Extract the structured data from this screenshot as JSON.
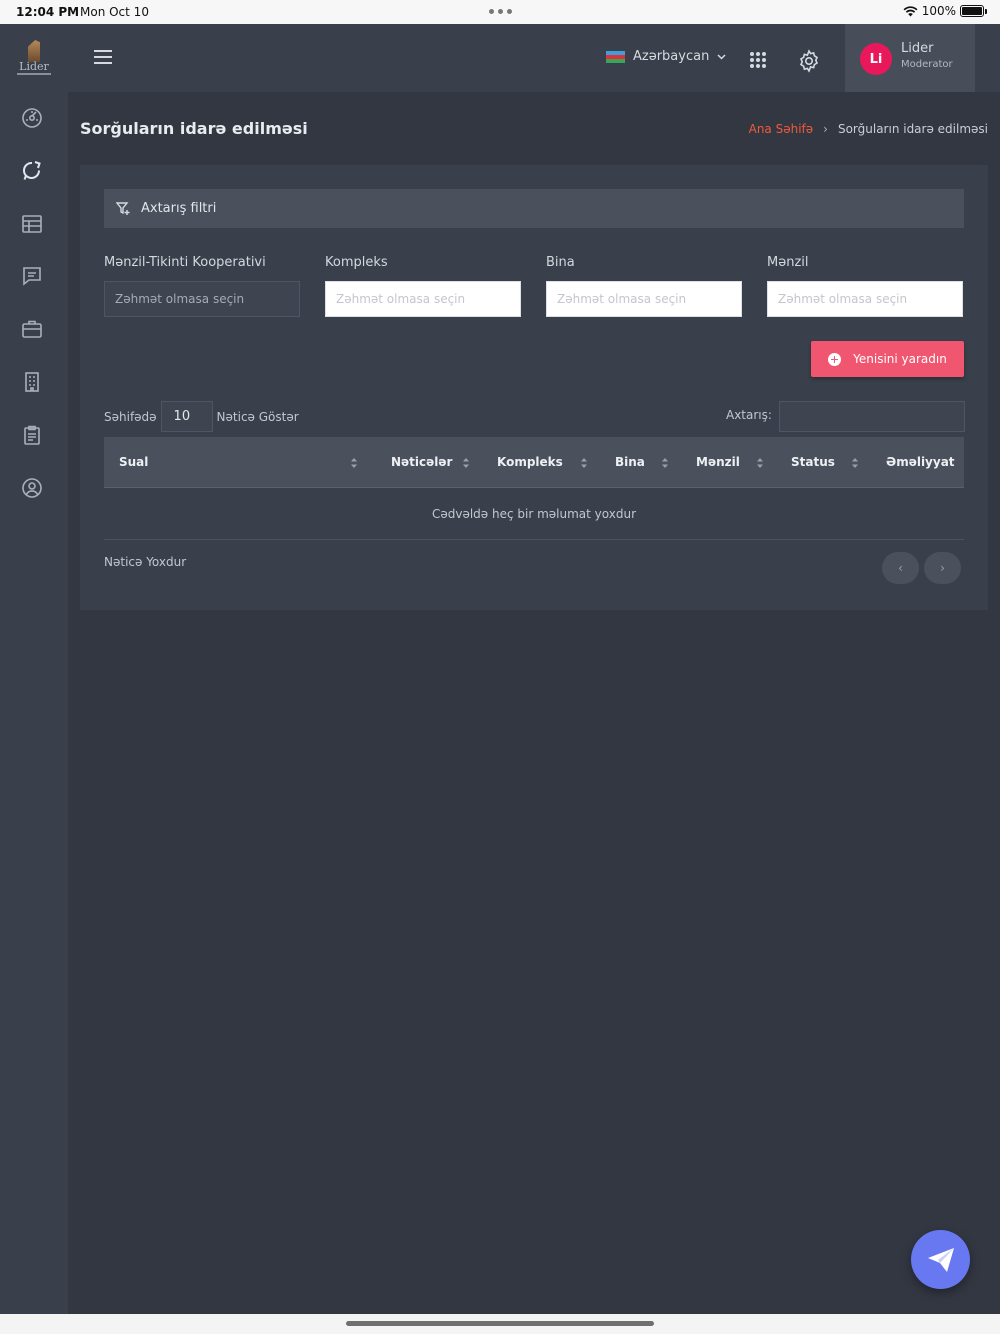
{
  "statusbar": {
    "time": "12:04 PM",
    "date": "Mon Oct 10",
    "battery": "100%"
  },
  "logo": {
    "text": "Lider"
  },
  "sidebar": {
    "icons": [
      "dashboard-icon",
      "refresh-chat-icon",
      "table-icon",
      "message-icon",
      "briefcase-icon",
      "building-icon",
      "clipboard-icon",
      "user-circle-icon"
    ]
  },
  "header": {
    "language": "Azərbaycan",
    "user": {
      "initials": "Li",
      "name": "Lider",
      "role": "Moderator"
    }
  },
  "page": {
    "title": "Sorğuların idarə edilməsi",
    "breadcrumb": {
      "home": "Ana Səhifə",
      "current": "Sorğuların idarə edilməsi"
    }
  },
  "filter": {
    "title": "Axtarış filtri",
    "fields": [
      {
        "label": "Mənzil-Tikinti Kooperativi",
        "placeholder": "Zəhmət olmasa seçin"
      },
      {
        "label": "Kompleks",
        "placeholder": "Zəhmət olmasa seçin"
      },
      {
        "label": "Bina",
        "placeholder": "Zəhmət olmasa seçin"
      },
      {
        "label": "Mənzil",
        "placeholder": "Zəhmət olmasa seçin"
      }
    ]
  },
  "actions": {
    "create_label": "Yenisini yaradın"
  },
  "table": {
    "per_page_prefix": "Səhifədə",
    "per_page_value": "10",
    "per_page_suffix": "Nəticə Göstər",
    "search_label": "Axtarış:",
    "columns": [
      "Sual",
      "Nəticələr",
      "Kompleks",
      "Bina",
      "Mənzil",
      "Status",
      "Əməliyyat"
    ],
    "empty_message": "Cədvəldə heç bir məlumat yoxdur",
    "result_info": "Nəticə Yoxdur",
    "pagination": {
      "prev": "‹",
      "next": "›"
    }
  },
  "colors": {
    "accent": "#f0566f",
    "avatar": "#e8185a",
    "fab": "#6878f0",
    "breadcrumb_home": "#f15a3a"
  }
}
